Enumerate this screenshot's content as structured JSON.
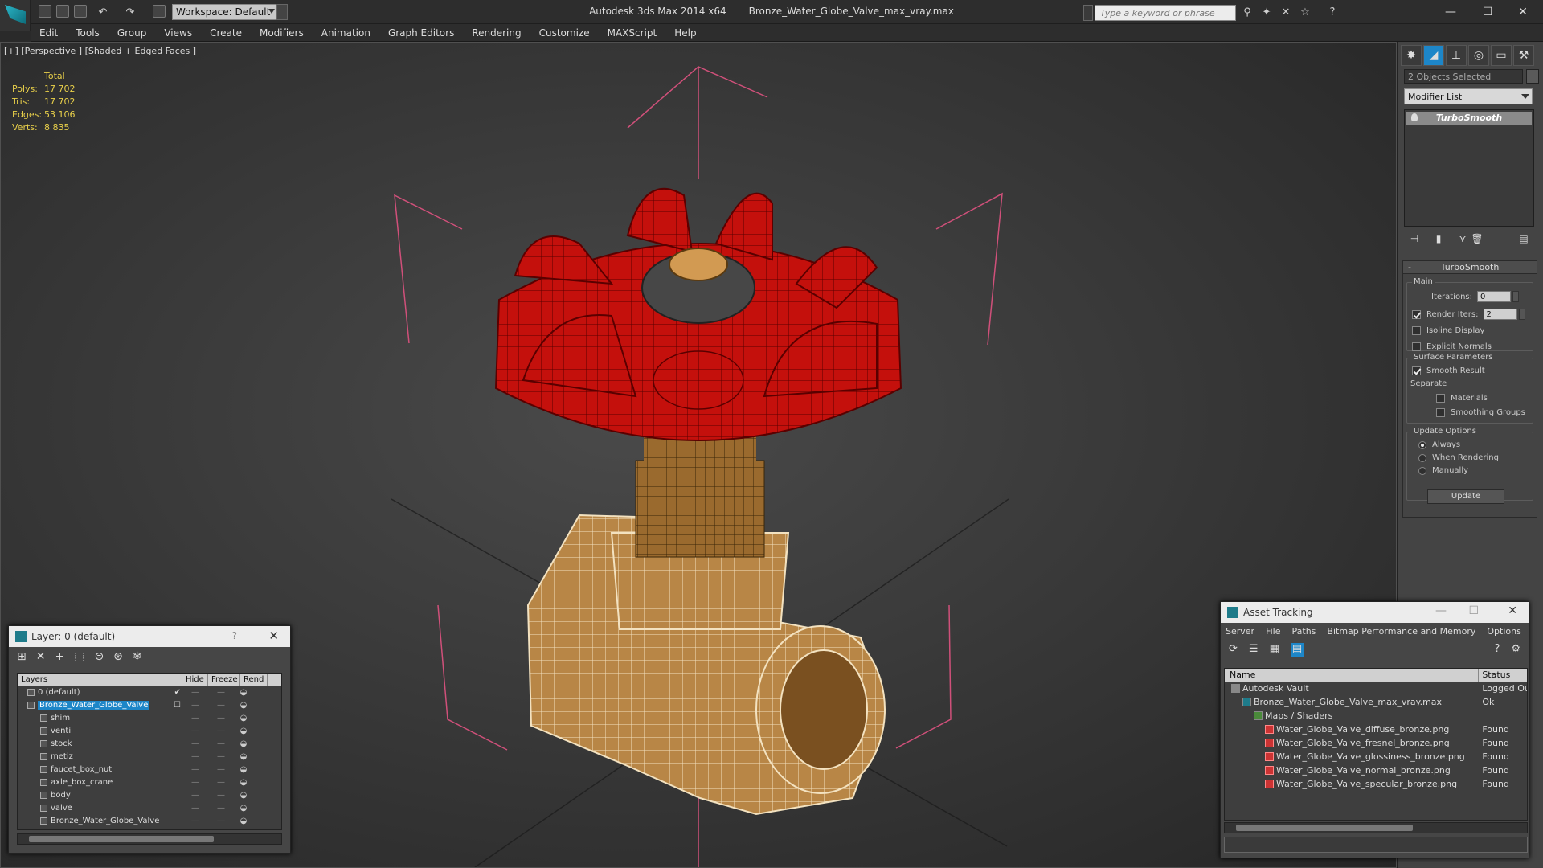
{
  "app": {
    "title": "Autodesk 3ds Max  2014 x64",
    "file": "Bronze_Water_Globe_Valve_max_vray.max",
    "workspace": "Workspace: Default",
    "search_placeholder": "Type a keyword or phrase",
    "accent": "#1d86c8"
  },
  "menu": [
    "Edit",
    "Tools",
    "Group",
    "Views",
    "Create",
    "Modifiers",
    "Animation",
    "Graph Editors",
    "Rendering",
    "Customize",
    "MAXScript",
    "Help"
  ],
  "viewport": {
    "label": "[+] [Perspective ] [Shaded + Edged Faces ]",
    "stats": {
      "header": "Total",
      "rows": [
        {
          "k": "Polys:",
          "v": "17 702"
        },
        {
          "k": "Tris:",
          "v": "17 702"
        },
        {
          "k": "Edges:",
          "v": "53 106"
        },
        {
          "k": "Verts:",
          "v": "8 835"
        }
      ]
    }
  },
  "command_panel": {
    "objects_selected": "2 Objects Selected",
    "modifier_list": "Modifier List",
    "stack_item": "TurboSmooth",
    "rollup_title": "TurboSmooth",
    "main_label": "Main",
    "iterations_label": "Iterations:",
    "iterations_value": "0",
    "render_iters_label": "Render Iters:",
    "render_iters_value": "2",
    "isoline": "Isoline Display",
    "explicit_normals": "Explicit Normals",
    "surface_params": "Surface Parameters",
    "smooth_result": "Smooth Result",
    "separate": "Separate",
    "materials": "Materials",
    "smoothing_groups": "Smoothing Groups",
    "update_options": "Update Options",
    "always": "Always",
    "when_rendering": "When Rendering",
    "manually": "Manually",
    "update_button": "Update"
  },
  "layer_dialog": {
    "title": "Layer: 0 (default)",
    "help": "?",
    "columns": [
      "Layers",
      "Hide",
      "Freeze",
      "Rend"
    ],
    "rows": [
      {
        "name": "0 (default)",
        "indent": 1,
        "check": "✔"
      },
      {
        "name": "Bronze_Water_Globe_Valve",
        "indent": 1,
        "check": "☐",
        "selected": true
      },
      {
        "name": "shim",
        "indent": 2
      },
      {
        "name": "ventil",
        "indent": 2
      },
      {
        "name": "stock",
        "indent": 2
      },
      {
        "name": "metiz",
        "indent": 2
      },
      {
        "name": "faucet_box_nut",
        "indent": 2
      },
      {
        "name": "axle_box_crane",
        "indent": 2
      },
      {
        "name": "body",
        "indent": 2
      },
      {
        "name": "valve",
        "indent": 2
      },
      {
        "name": "Bronze_Water_Globe_Valve",
        "indent": 2
      }
    ]
  },
  "asset_tracking": {
    "title": "Asset Tracking",
    "menu": [
      "Server",
      "File",
      "Paths",
      "Bitmap Performance and Memory",
      "Options"
    ],
    "columns": [
      "Name",
      "Status"
    ],
    "rows": [
      {
        "name": "Autodesk Vault",
        "status": "Logged Ou",
        "indent": 1,
        "icon": "vault"
      },
      {
        "name": "Bronze_Water_Globe_Valve_max_vray.max",
        "status": "Ok",
        "indent": 2,
        "icon": "mx"
      },
      {
        "name": "Maps / Shaders",
        "status": "",
        "indent": 3,
        "icon": "map"
      },
      {
        "name": "Water_Globe_Valve_diffuse_bronze.png",
        "status": "Found",
        "indent": 4,
        "icon": "png"
      },
      {
        "name": "Water_Globe_Valve_fresnel_bronze.png",
        "status": "Found",
        "indent": 4,
        "icon": "png"
      },
      {
        "name": "Water_Globe_Valve_glossiness_bronze.png",
        "status": "Found",
        "indent": 4,
        "icon": "png"
      },
      {
        "name": "Water_Globe_Valve_normal_bronze.png",
        "status": "Found",
        "indent": 4,
        "icon": "png"
      },
      {
        "name": "Water_Globe_Valve_specular_bronze.png",
        "status": "Found",
        "indent": 4,
        "icon": "png"
      }
    ]
  }
}
